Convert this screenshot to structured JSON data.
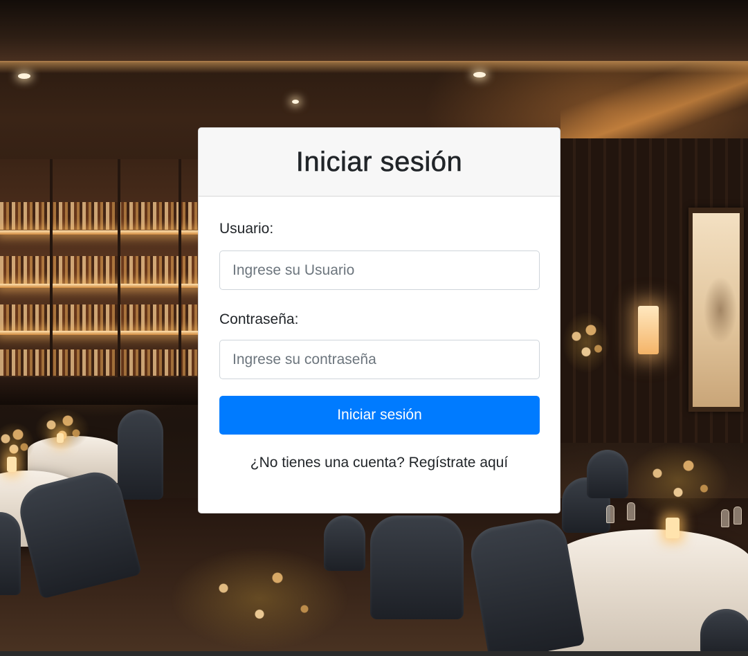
{
  "login": {
    "title": "Iniciar sesión",
    "username_label": "Usuario:",
    "username_placeholder": "Ingrese su Usuario",
    "username_value": "",
    "password_label": "Contraseña:",
    "password_placeholder": "Ingrese su contraseña",
    "password_value": "",
    "submit_label": "Iniciar sesión",
    "register_prompt": "¿No tienes una cuenta?",
    "register_link": "Regístrate aquí"
  },
  "colors": {
    "primary_button": "#007bff",
    "card_header_bg": "#f7f7f7",
    "text": "#212529"
  },
  "background": {
    "description_icon": "restaurant-interior-photo"
  }
}
